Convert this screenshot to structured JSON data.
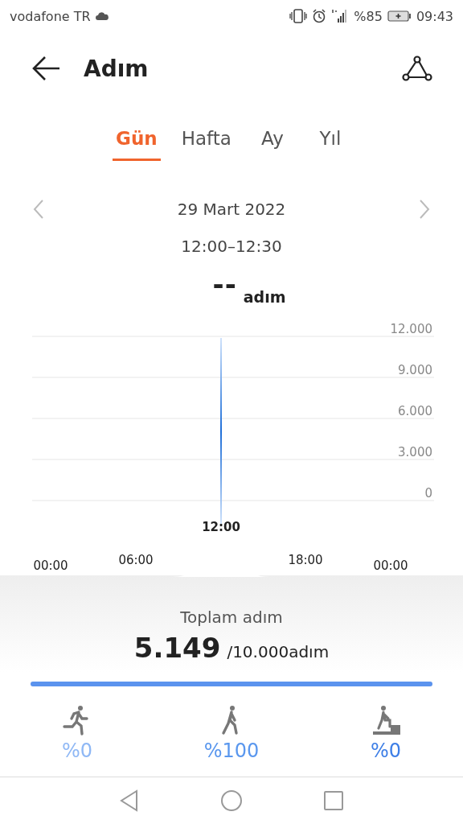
{
  "status_bar": {
    "carrier": "vodafone TR",
    "battery": "%85",
    "time": "09:43"
  },
  "header": {
    "title": "Adım"
  },
  "tabs": [
    {
      "label": "Gün",
      "selected": true
    },
    {
      "label": "Hafta",
      "selected": false
    },
    {
      "label": "Ay",
      "selected": false
    },
    {
      "label": "Yıl",
      "selected": false
    }
  ],
  "date": "29 Mart 2022",
  "time_range": "12:00–12:30",
  "reading": {
    "value": "--",
    "unit": "adım"
  },
  "chart": {
    "y_labels": [
      "12.000",
      "9.000",
      "6.000",
      "3.000",
      "0"
    ],
    "marker_label": "12:00",
    "x_labels": [
      "00:00",
      "06:00",
      "18:00",
      "00:00"
    ]
  },
  "summary": {
    "label": "Toplam adım",
    "value": "5.149",
    "goal": "/10.000adım",
    "level": 1
  },
  "activities": [
    {
      "kind": "run",
      "percent": "%0",
      "color": "#8fb8f5"
    },
    {
      "kind": "walk",
      "percent": "%100",
      "color": "#5a97ee"
    },
    {
      "kind": "climb",
      "percent": "%0",
      "color": "#3d7ee6"
    }
  ]
}
